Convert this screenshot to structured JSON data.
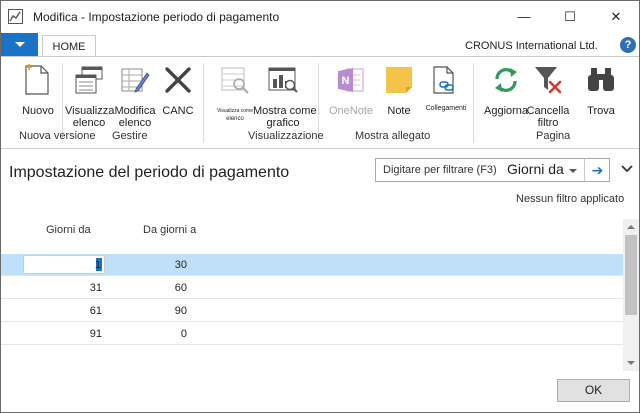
{
  "window": {
    "title": "Modifica - Impostazione periodo di pagamento",
    "minimize": "—",
    "maximize": "☐",
    "close": "✕"
  },
  "ribbon_tabs": {
    "home": "HOME",
    "company": "CRONUS International Ltd.",
    "help": "?"
  },
  "ribbon": {
    "buttons": {
      "nuovo": "Nuovo",
      "visualizza_elenco_1": "Visualizza",
      "visualizza_elenco_2": "elenco",
      "modifica_elenco_1": "Modifica",
      "modifica_elenco_2": "elenco",
      "canc": "CANC",
      "visualizza_come_elenco_1": "Visualizza come",
      "visualizza_come_elenco_2": "elenco",
      "mostra_grafico_1": "Mostra come",
      "mostra_grafico_2": "grafico",
      "onenote": "OneNote",
      "note": "Note",
      "collegamenti": "Collegamenti",
      "aggiorna": "Aggiorna",
      "cancella_filtro_1": "Cancella",
      "cancella_filtro_2": "filtro",
      "trova": "Trova"
    },
    "groups": {
      "nuova_versione": "Nuova versione",
      "gestire": "Gestire",
      "visualizzazione": "Visualizzazione",
      "mostra_allegato": "Mostra allegato",
      "pagina": "Pagina"
    },
    "colors": {
      "accent": "#1b73c5",
      "onenote": "#7a3f9d",
      "note": "#f5c24a",
      "refresh": "#2f9b5a",
      "delete": "#d13b2f"
    }
  },
  "page": {
    "title": "Impostazione del periodo di pagamento",
    "filter_hint": "Digitare per filtrare (F3)",
    "filter_field": "Giorni da",
    "no_filter": "Nessun filtro applicato"
  },
  "grid": {
    "columns": [
      "Giorni da",
      "Da giorni a"
    ],
    "rows": [
      {
        "giorni_da": "1",
        "da_giorni_a": "30"
      },
      {
        "giorni_da": "31",
        "da_giorni_a": "60"
      },
      {
        "giorni_da": "61",
        "da_giorni_a": "90"
      },
      {
        "giorni_da": "91",
        "da_giorni_a": "0"
      }
    ]
  },
  "footer": {
    "ok": "OK"
  }
}
